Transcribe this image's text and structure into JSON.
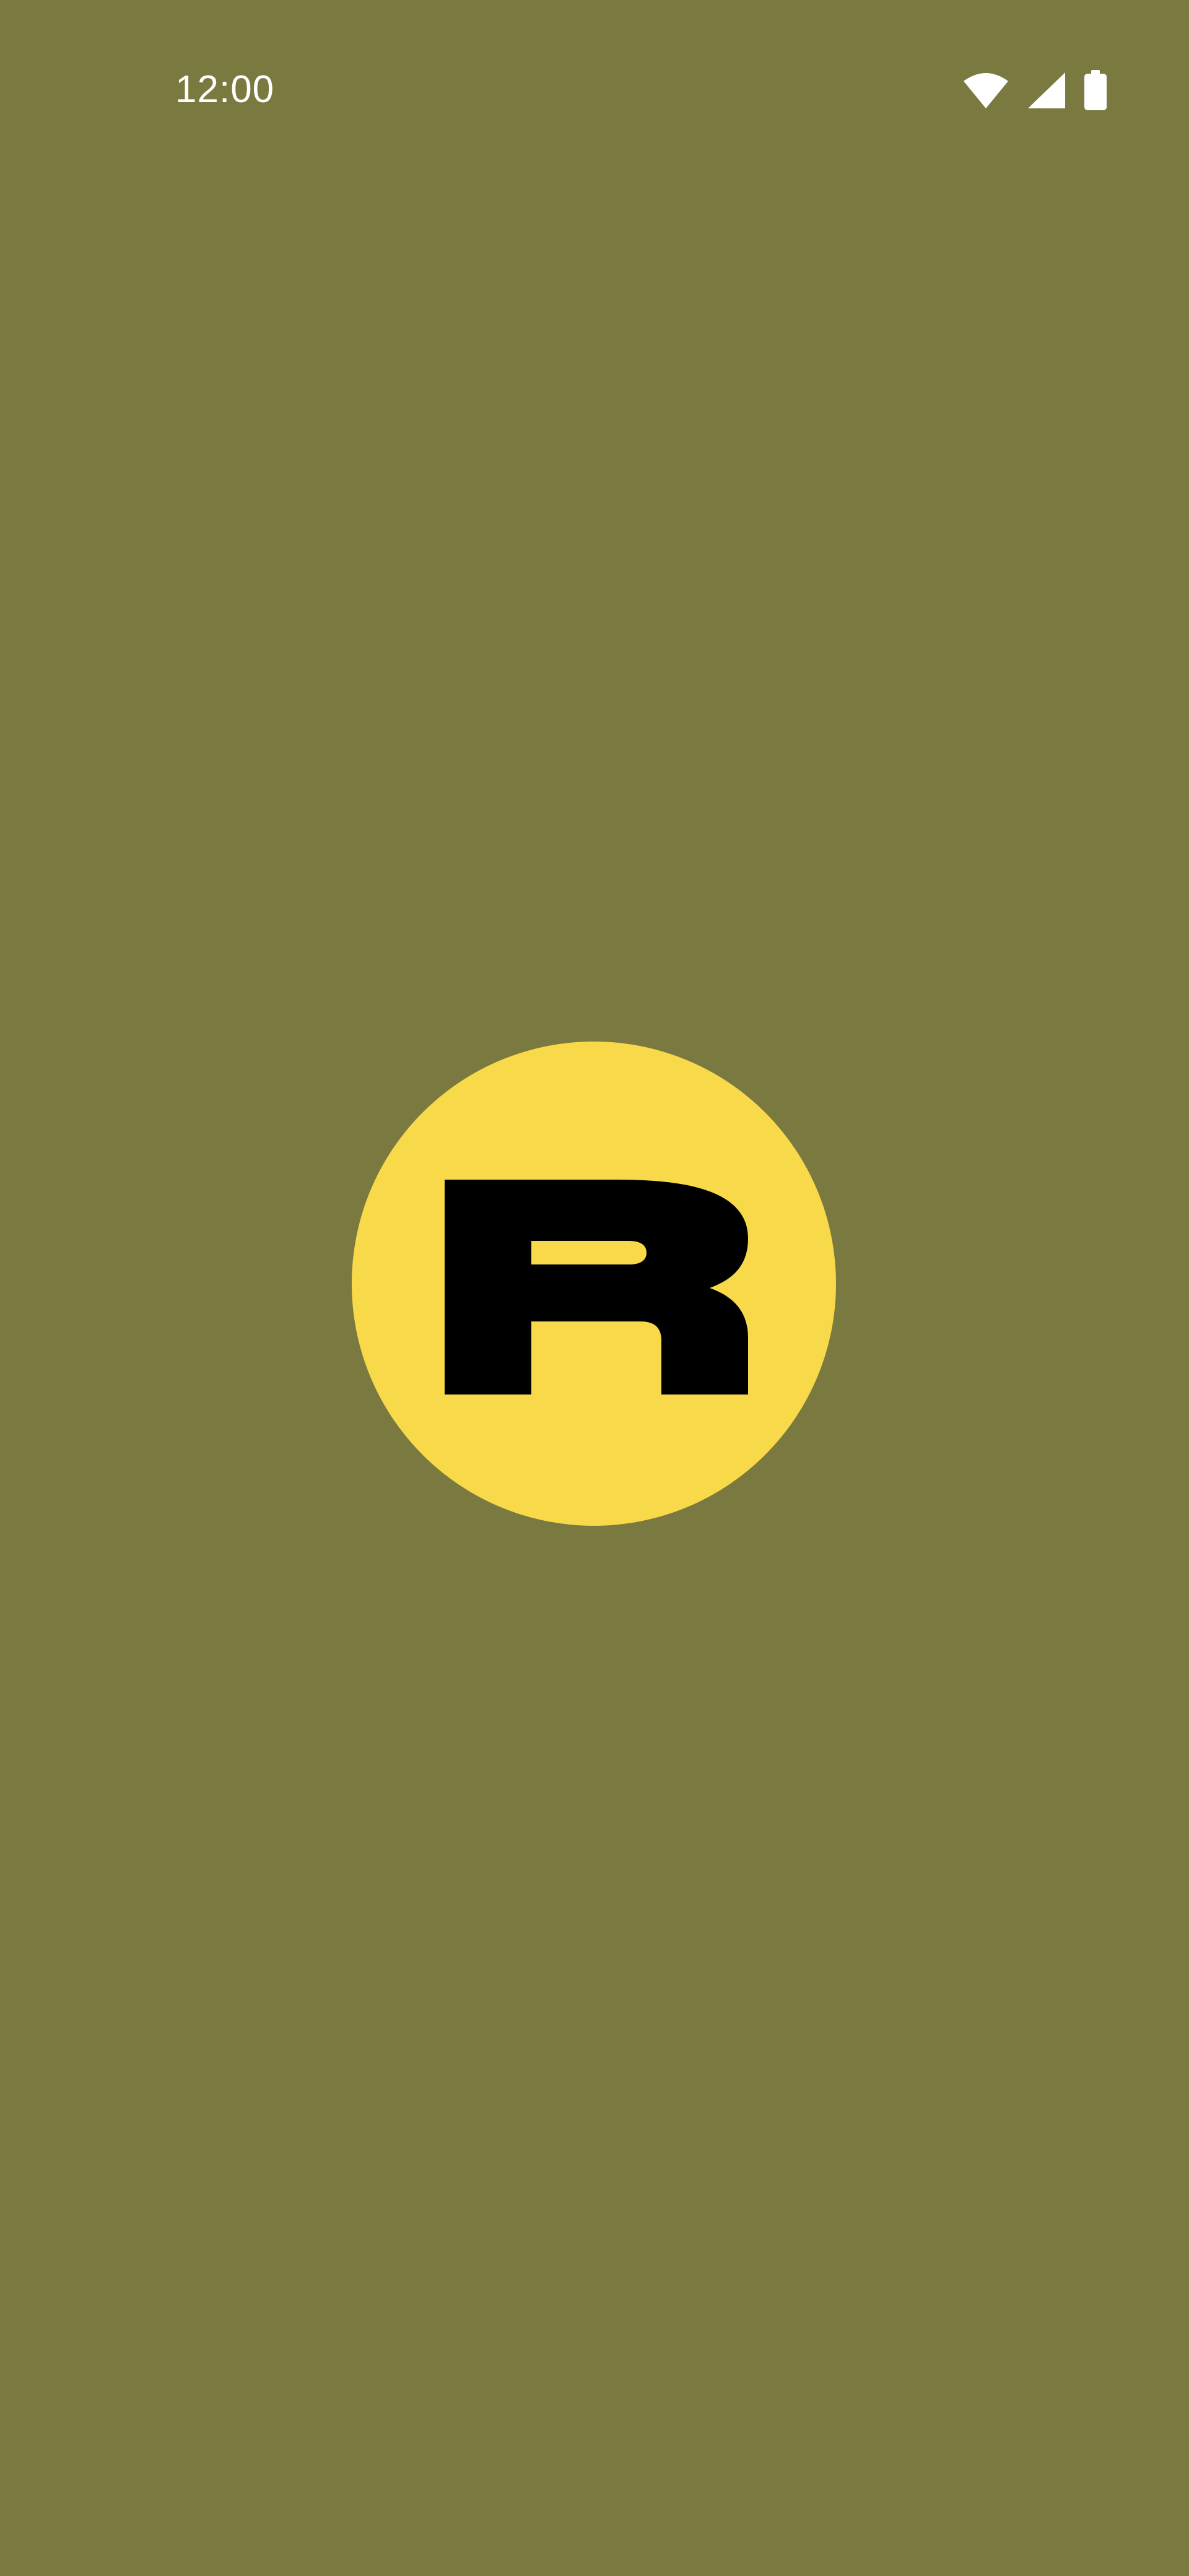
{
  "status_bar": {
    "time": "12:00",
    "icons": [
      "wifi-icon",
      "cellular-signal-icon",
      "battery-icon"
    ]
  },
  "splash": {
    "logo": "app-logo-r"
  },
  "colors": {
    "background": "#7a7a40",
    "logo_circle": "#f8d94a",
    "logo_glyph": "#000000",
    "status_foreground": "#ffffff"
  }
}
